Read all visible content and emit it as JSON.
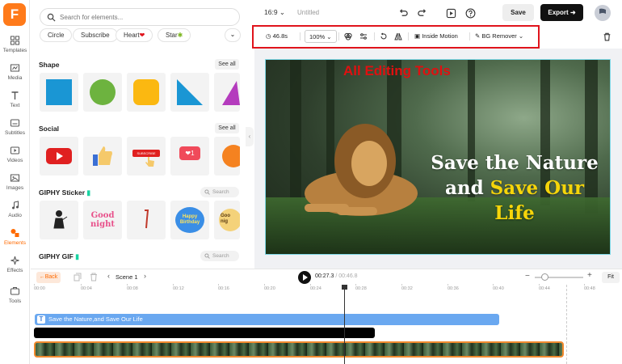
{
  "rail": {
    "items": [
      {
        "label": "Templates"
      },
      {
        "label": "Media"
      },
      {
        "label": "Text"
      },
      {
        "label": "Subtitles"
      },
      {
        "label": "Videos"
      },
      {
        "label": "Images"
      },
      {
        "label": "Audio"
      },
      {
        "label": "Elements"
      },
      {
        "label": "Effects"
      },
      {
        "label": "Tools"
      }
    ],
    "active": "Elements",
    "logo_letter": "F"
  },
  "panel": {
    "search_placeholder": "Search for elements...",
    "chips": [
      "Circle",
      "Subscribe",
      "Heart",
      "Star"
    ],
    "sections": {
      "shape": {
        "title": "Shape",
        "see_all": "See all"
      },
      "social": {
        "title": "Social",
        "see_all": "See all"
      },
      "giphy_sticker": {
        "title": "GIPHY Sticker",
        "search": "Search"
      },
      "giphy_gif": {
        "title": "GIPHY GIF",
        "search": "Search"
      }
    },
    "social_tiles": {
      "subscribe": "SUBSCRIBE",
      "like_count": "1"
    },
    "sticker_tiles": {
      "good_night": "Good night",
      "happy_birthday": "Happy Birthday",
      "good": "Goo nig"
    }
  },
  "topbar": {
    "aspect_ratio": "16:9",
    "title": "Untitled",
    "save": "Save",
    "export": "Export"
  },
  "edit_bar": {
    "duration": "46.8s",
    "zoom": "100%",
    "inside_motion": "Inside Motion",
    "bg_remover": "BG Remover"
  },
  "canvas": {
    "overlay_label": "All Editing Tools",
    "headline_line1": "Save the Nature",
    "headline_line2_plain": "and ",
    "headline_line2_highlight": "Save Our Life"
  },
  "timeline": {
    "back": "Back",
    "scene": "Scene 1",
    "current_time": "00:27.3",
    "total_time": "/ 00:46.8",
    "fit": "Fit",
    "ruler_ticks": [
      "00:00",
      "00:04",
      "00:08",
      "00:12",
      "00:16",
      "00:20",
      "00:24",
      "00:28",
      "00:32",
      "00:36",
      "00:40",
      "00:44",
      "00:48"
    ],
    "text_track_label": "Save the Nature,and Save Our Life",
    "text_track_icon": "T"
  },
  "colors": {
    "brand": "#ff7a1a",
    "highlight_box": "#e0141c",
    "text_track": "#6aa8f0",
    "video_border": "#f28a2e",
    "headline_highlight": "#f6d50a"
  }
}
